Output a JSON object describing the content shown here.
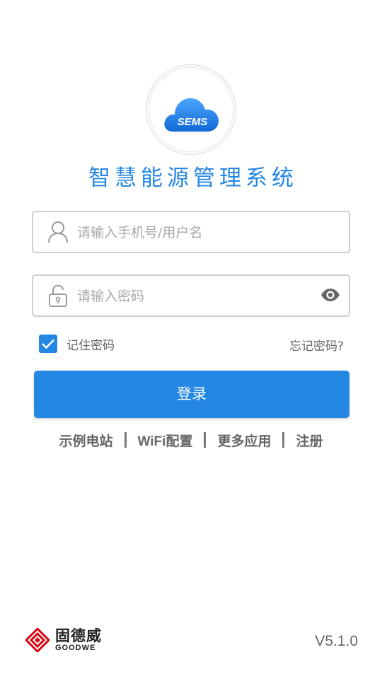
{
  "logo": {
    "text": "SEMS",
    "icon": "cloud-icon"
  },
  "app_title": "智慧能源管理系统",
  "username": {
    "value": "",
    "placeholder": "请输入手机号/用户名",
    "icon": "user-icon"
  },
  "password": {
    "value": "",
    "placeholder": "请输入密码",
    "icon": "lock-icon",
    "toggle_icon": "eye-icon"
  },
  "remember": {
    "label": "记住密码",
    "checked": true
  },
  "forgot_label": "忘记密码?",
  "login_label": "登录",
  "links": [
    "示例电站",
    "WiFi配置",
    "更多应用",
    "注册"
  ],
  "brand": {
    "name": "固德威",
    "name_en": "GOODWE"
  },
  "version": "V5.1.0",
  "colors": {
    "primary": "#2587e4",
    "brand_red": "#d7000f"
  }
}
